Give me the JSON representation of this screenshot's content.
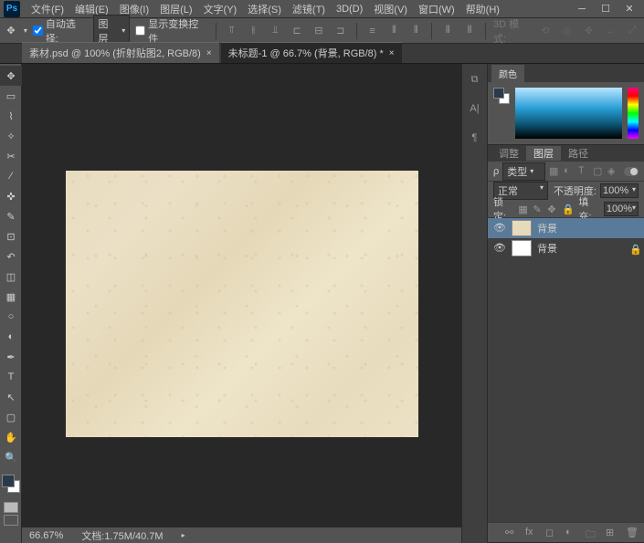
{
  "app": {
    "logo": "Ps"
  },
  "menu": {
    "file": "文件(F)",
    "edit": "编辑(E)",
    "image": "图像(I)",
    "layer": "图层(L)",
    "type": "文字(Y)",
    "select": "选择(S)",
    "filter": "滤镜(T)",
    "threed": "3D(D)",
    "view": "视图(V)",
    "window": "窗口(W)",
    "help": "帮助(H)"
  },
  "options": {
    "auto_select": "自动选择:",
    "auto_select_value": "图层",
    "show_transform": "显示变换控件",
    "threed_mode": "3D 模式:"
  },
  "tabs": {
    "tab1": "素材.psd @ 100% (折射贴图2, RGB/8)",
    "tab2": "未标题-1 @ 66.7% (背景, RGB/8) *"
  },
  "panels": {
    "color_tab": "颜色",
    "adjustments": "调整",
    "layers": "图层",
    "paths": "路径",
    "filter_type": "类型",
    "blend_mode": "正常",
    "opacity_label": "不透明度:",
    "opacity_value": "100%",
    "lock_label": "锁定:",
    "fill_label": "填充:",
    "fill_value": "100%"
  },
  "layers": {
    "layer1": "背景",
    "layer2": "背景"
  },
  "status": {
    "zoom": "66.67%",
    "doc_info": "文档:1.75M/40.7M"
  },
  "colors": {
    "foreground": "#2a3a4a",
    "swatch_fg": "#2a3a4a"
  }
}
